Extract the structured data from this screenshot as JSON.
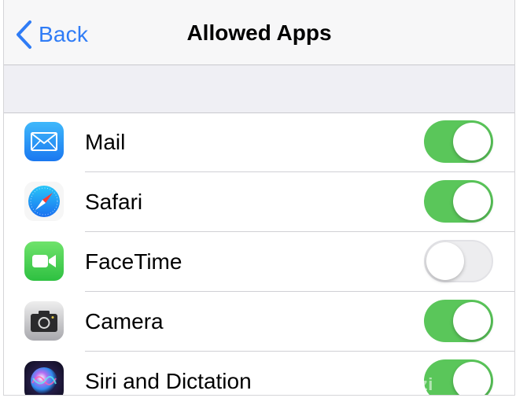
{
  "nav": {
    "back_label": "Back",
    "title": "Allowed Apps"
  },
  "colors": {
    "accent": "#2f7cf6",
    "toggle_on": "#5ac65a",
    "toggle_off": "#ededef"
  },
  "apps": [
    {
      "label": "Mail",
      "icon": "mail-icon",
      "enabled": true
    },
    {
      "label": "Safari",
      "icon": "safari-icon",
      "enabled": true
    },
    {
      "label": "FaceTime",
      "icon": "facetime-icon",
      "enabled": false
    },
    {
      "label": "Camera",
      "icon": "camera-icon",
      "enabled": true
    },
    {
      "label": "Siri and Dictation",
      "icon": "siri-icon",
      "enabled": true
    }
  ],
  "watermark": "mazi"
}
